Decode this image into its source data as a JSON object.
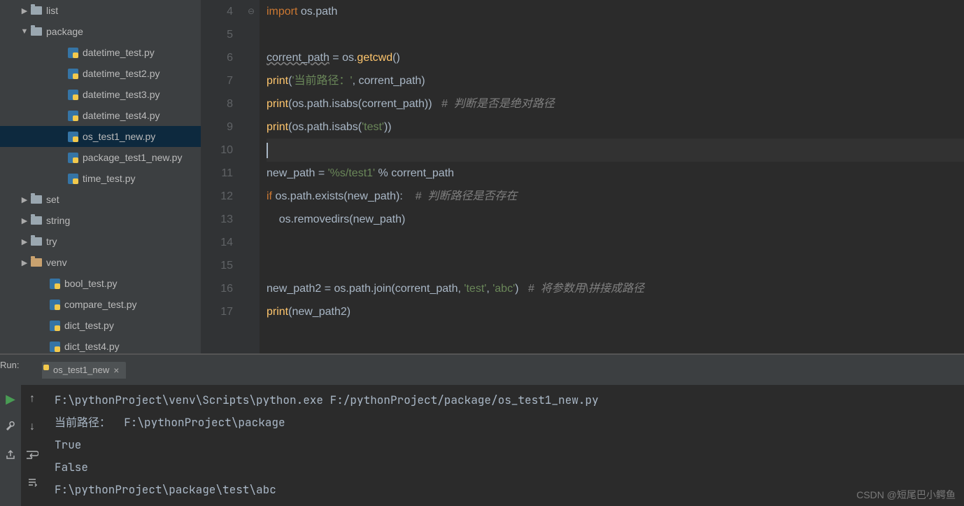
{
  "sidebar": {
    "items": [
      {
        "indent": 28,
        "arrow": "▶",
        "type": "folder",
        "label": "list"
      },
      {
        "indent": 28,
        "arrow": "▼",
        "type": "folder",
        "label": "package"
      },
      {
        "indent": 80,
        "arrow": "",
        "type": "py",
        "label": "datetime_test.py"
      },
      {
        "indent": 80,
        "arrow": "",
        "type": "py",
        "label": "datetime_test2.py"
      },
      {
        "indent": 80,
        "arrow": "",
        "type": "py",
        "label": "datetime_test3.py"
      },
      {
        "indent": 80,
        "arrow": "",
        "type": "py",
        "label": "datetime_test4.py"
      },
      {
        "indent": 80,
        "arrow": "",
        "type": "py",
        "label": "os_test1_new.py",
        "selected": true
      },
      {
        "indent": 80,
        "arrow": "",
        "type": "py",
        "label": "package_test1_new.py"
      },
      {
        "indent": 80,
        "arrow": "",
        "type": "py",
        "label": "time_test.py"
      },
      {
        "indent": 28,
        "arrow": "▶",
        "type": "folder",
        "label": "set"
      },
      {
        "indent": 28,
        "arrow": "▶",
        "type": "folder",
        "label": "string"
      },
      {
        "indent": 28,
        "arrow": "▶",
        "type": "folder",
        "label": "try"
      },
      {
        "indent": 28,
        "arrow": "▶",
        "type": "folder",
        "label": "venv",
        "venv": true
      },
      {
        "indent": 54,
        "arrow": "",
        "type": "py",
        "label": "bool_test.py"
      },
      {
        "indent": 54,
        "arrow": "",
        "type": "py",
        "label": "compare_test.py"
      },
      {
        "indent": 54,
        "arrow": "",
        "type": "py",
        "label": "dict_test.py"
      },
      {
        "indent": 54,
        "arrow": "",
        "type": "py",
        "label": "dict_test4.py"
      }
    ]
  },
  "editor": {
    "line_numbers": [
      "4",
      "5",
      "6",
      "7",
      "8",
      "9",
      "10",
      "11",
      "12",
      "13",
      "14",
      "15",
      "16",
      "17"
    ],
    "code": {
      "l4": {
        "kw": "import",
        "rest": " os.path"
      },
      "l6": {
        "warn": "corrent_path",
        "rest": " = os.",
        "fn": "getcwd",
        "paren": "()"
      },
      "l7": {
        "fn": "print",
        "open": "(",
        "str": "'当前路径：'",
        "mid": ", corrent_path)"
      },
      "l8a": {
        "fn": "print",
        "body": "(os.path.isabs(corrent_path))"
      },
      "l8c": "#  判断是否是绝对路径",
      "l9": {
        "fn": "print",
        "open": "(os.path.isabs(",
        "str": "'test'",
        "close": "))"
      },
      "l11": {
        "left": "new_path = ",
        "str": "'%s/test1'",
        "right": " % corrent_path"
      },
      "l12": {
        "kw": "if",
        "body": " os.path.exists(new_path):",
        "cmt": "#  判断路径是否存在"
      },
      "l13": "    os.removedirs(new_path)",
      "l16a": {
        "left": "new_path2 = os.path.join(corrent_path, ",
        "s1": "'test'",
        "mid": ", ",
        "s2": "'abc'",
        "close": ")"
      },
      "l16c": "#  将参数用\\拼接成路径",
      "l17": {
        "fn": "print",
        "body": "(new_path2)"
      }
    }
  },
  "run": {
    "label": "Run:",
    "tab_name": "os_test1_new",
    "output": [
      "F:\\pythonProject\\venv\\Scripts\\python.exe F:/pythonProject/package/os_test1_new.py",
      "当前路径：  F:\\pythonProject\\package",
      "True",
      "False",
      "F:\\pythonProject\\package\\test\\abc"
    ]
  },
  "watermark": "CSDN @短尾巴小鳄鱼"
}
